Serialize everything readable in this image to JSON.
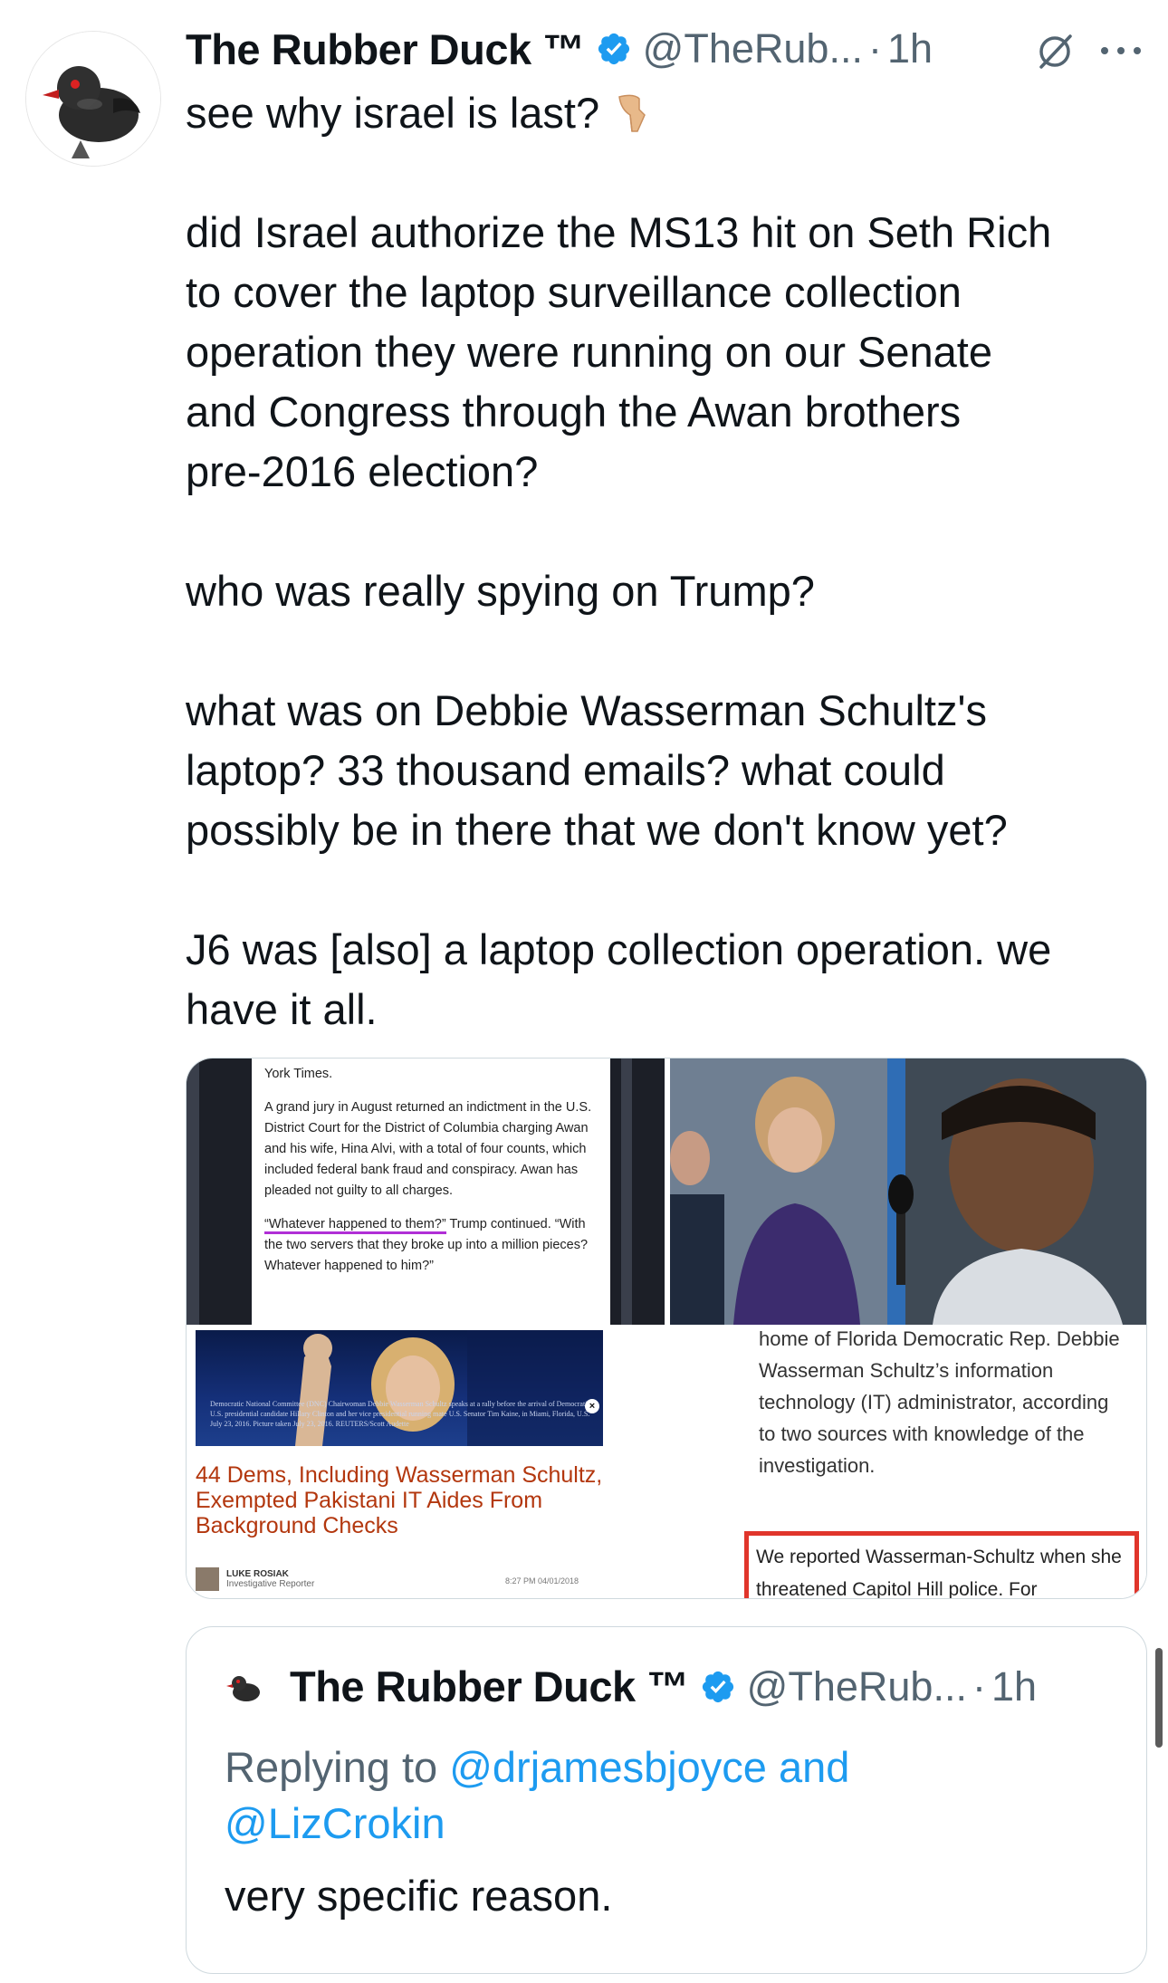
{
  "tweet": {
    "author_name": "The Rubber Duck ™",
    "author_handle": "@TheRub...",
    "separator": "·",
    "time": "1h",
    "icons": {
      "avatar": "rubber-duck-avatar",
      "verified": "verified-badge-icon",
      "grok": "grok-icon",
      "more": "more-options-icon",
      "emoji": "backhand-index-pointing-down-emoji"
    },
    "paragraphs": [
      [
        "see why israel is last?"
      ],
      [
        "did Israel authorize the MS13 hit on Seth Rich",
        "to cover the laptop surveillance collection",
        "operation they were running on our Senate",
        "and Congress through the Awan brothers",
        "pre-2016 election?"
      ],
      [
        "who was really spying on Trump?"
      ],
      [
        "what was on Debbie Wasserman Schultz's",
        "laptop? 33 thousand emails? what could",
        "possibly be in there that we don't know yet?"
      ],
      [
        "J6 was [also] a laptop collection operation. we",
        "have it all."
      ]
    ]
  },
  "media": {
    "tile1": {
      "lines": [
        "York Times.",
        "A grand jury in August returned an indictment in the U.S. District Court for the District of Columbia charging Awan and his wife, Hina Alvi, with a total of four counts, which included federal bank fraud and conspiracy. Awan has pleaded not guilty to all charges.",
        "“Whatever happened to them?”",
        " Trump continued. “With the two servers that they broke up into a million pieces? Whatever happened to him?”"
      ]
    },
    "tile2": {
      "description": "photo"
    },
    "tile3": {
      "caption": "Democratic National Committee (DNC) Chairwoman Debbie Wasserman Schultz speaks at a rally before the arrival of Democratic U.S. presidential candidate Hillary Clinton and her vice presidential running mate U.S. Senator Tim Kaine, in Miami, Florida, U.S. July 23, 2016. Picture taken July 23, 2016. REUTERS/Scott Audette",
      "headline": "44 Dems, Including Wasserman Schultz, Exempted Pakistani IT Aides From Background Checks",
      "author": "LUKE ROSIAK",
      "author_role": "Investigative Reporter",
      "date": "8:27 PM 04/01/2018"
    },
    "tile4": {
      "text": "home of Florida Democratic Rep. Debbie Wasserman Schultz’s information technology (IT) administrator, according to two sources with knowledge of the investigation.",
      "boxed_text": "We reported Wasserman-Schultz when she threatened Capitol Hill police. For"
    }
  },
  "quote": {
    "author_name": "The Rubber Duck ™",
    "author_handle": "@TheRub...",
    "separator": "·",
    "time": "1h",
    "reply_prefix": "Replying to ",
    "mention1": "@drjamesbjoyce",
    "conjunction": " and",
    "mention2": "@LizCrokin",
    "text": "very specific reason."
  },
  "colors": {
    "text": "#0f1419",
    "secondary": "#536471",
    "link": "#1d9bf0",
    "verified": "#1d9bf0",
    "border": "#cfd9de"
  }
}
